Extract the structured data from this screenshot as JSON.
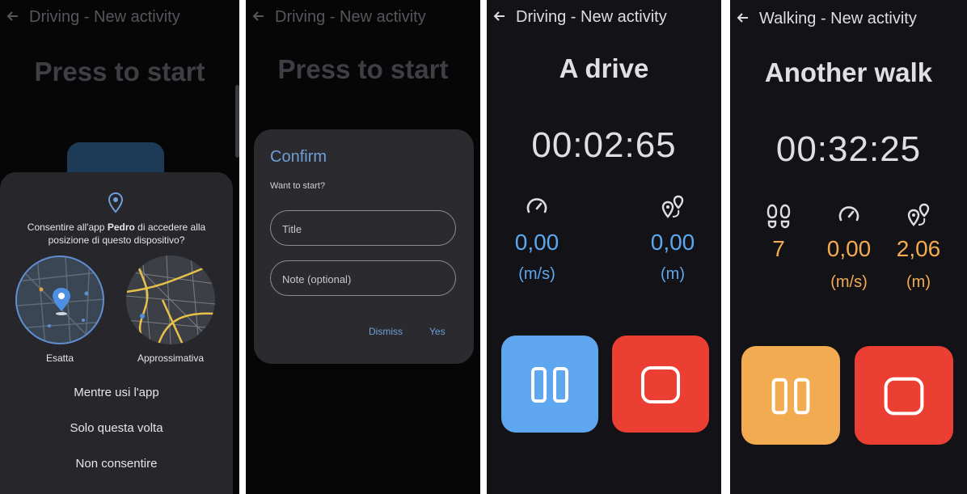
{
  "colors": {
    "blue": "#5ea7ee",
    "red": "#ec3f33",
    "orange": "#f3ab52",
    "accent_text": "#6f9fd8"
  },
  "screen1": {
    "title": "Driving - New activity",
    "headline": "Press to start",
    "permission": {
      "text_before": "Consentire all'app ",
      "app_name": "Pedro",
      "text_after": " di accedere alla posizione di questo dispositivo?",
      "exact_label": "Esatta",
      "approx_label": "Approssimativa",
      "options": [
        "Mentre usi l'app",
        "Solo questa volta",
        "Non consentire"
      ]
    }
  },
  "screen2": {
    "title": "Driving - New activity",
    "headline": "Press to start",
    "dialog": {
      "title": "Confirm",
      "subtitle": "Want to start?",
      "title_placeholder": "Title",
      "note_placeholder": "Note (optional)",
      "dismiss": "Dismiss",
      "yes": "Yes"
    }
  },
  "screen3": {
    "title": "Driving - New activity",
    "headline": "A drive",
    "timer": "00:02:65",
    "speed": {
      "value": "0,00",
      "unit": "(m/s)"
    },
    "distance": {
      "value": "0,00",
      "unit": "(m)"
    }
  },
  "screen4": {
    "title": "Walking - New activity",
    "headline": "Another walk",
    "timer": "00:32:25",
    "steps": {
      "value": "7"
    },
    "speed": {
      "value": "0,00",
      "unit": "(m/s)"
    },
    "distance": {
      "value": "2,06",
      "unit": "(m)"
    }
  }
}
